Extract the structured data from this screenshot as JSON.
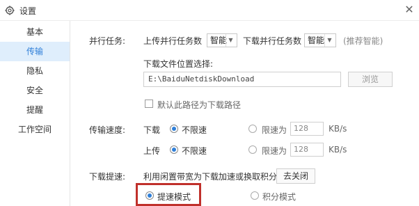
{
  "window": {
    "title": "设置",
    "close_glyph": "✕"
  },
  "sidebar": {
    "items": [
      {
        "label": "基本"
      },
      {
        "label": "传输"
      },
      {
        "label": "隐私"
      },
      {
        "label": "安全"
      },
      {
        "label": "提醒"
      },
      {
        "label": "工作空间"
      }
    ],
    "active": "传输"
  },
  "parallel": {
    "section_label": "并行任务:",
    "upload_label": "上传并行任务数",
    "upload_value": "智能",
    "download_label": "下载并行任务数",
    "download_value": "智能",
    "hint": "(推荐智能)"
  },
  "download_path": {
    "label": "下载文件位置选择:",
    "value": "E:\\BaiduNetdiskDownload",
    "browse_label": "浏览",
    "default_checkbox_label": "默认此路径为下载路径"
  },
  "speed": {
    "section_label": "传输速度:",
    "download_label": "下载",
    "upload_label": "上传",
    "unlimited_label": "不限速",
    "limit_label": "限速为",
    "download_limit": "128",
    "upload_limit": "128",
    "unit": "KB/s"
  },
  "boost": {
    "section_label": "下载提速:",
    "desc": "利用闲置带宽为下载加速或换取积分",
    "close_button": "去关闭",
    "mode_fast": "提速模式",
    "mode_points": "积分模式"
  },
  "colors": {
    "accent": "#2f7fd8",
    "highlight": "#c0302b",
    "active_bg": "#dfeefc"
  }
}
